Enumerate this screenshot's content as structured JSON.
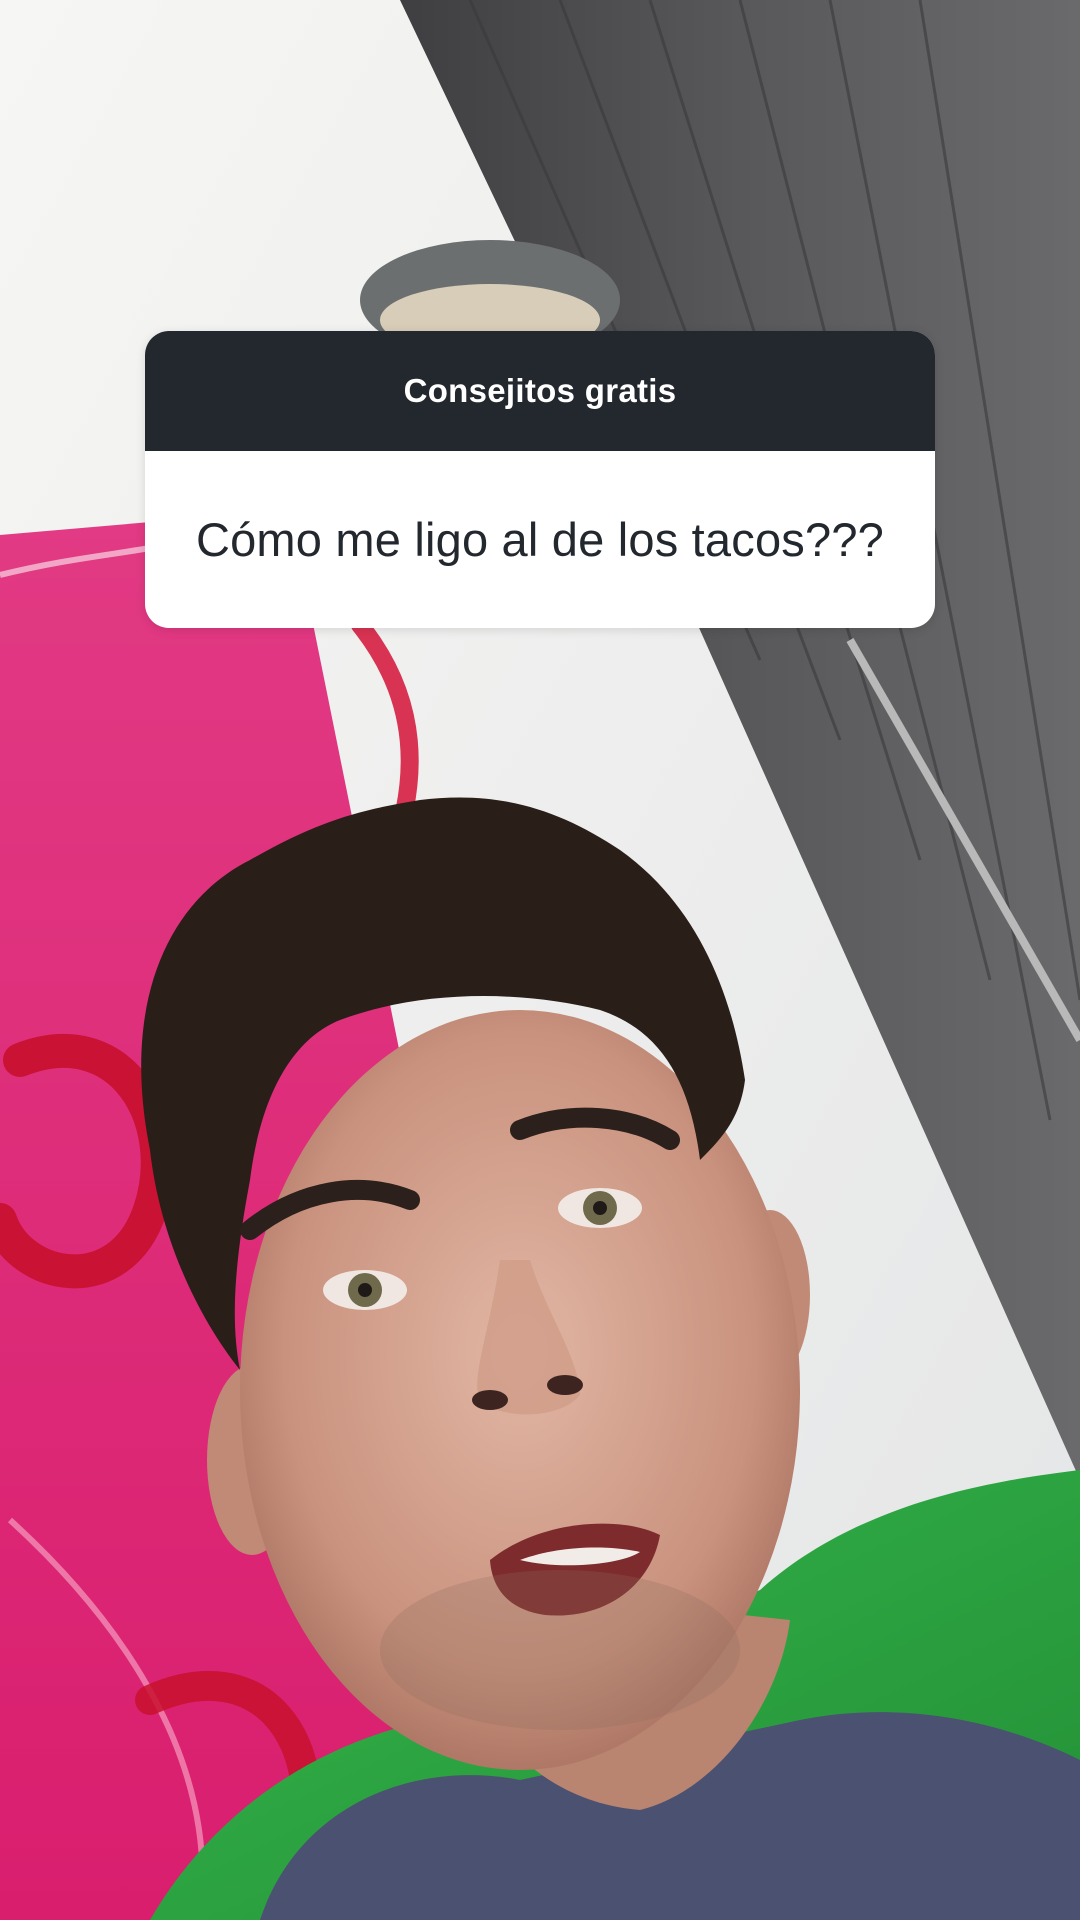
{
  "question_sticker": {
    "title": "Consejitos gratis",
    "question": "Cómo me ligo al de los tacos???"
  },
  "background": {
    "icon": "selfie-video-frame"
  },
  "colors": {
    "sticker_header": "#23272e",
    "sticker_body": "#ffffff",
    "sticker_text_dark": "#23272e",
    "wall_white": "#f3f3f1",
    "wall_pink": "#e0287a",
    "curtain_gray": "#4e4e50",
    "cushion_green": "#2ea843",
    "shirt_blue": "#4c5270"
  }
}
